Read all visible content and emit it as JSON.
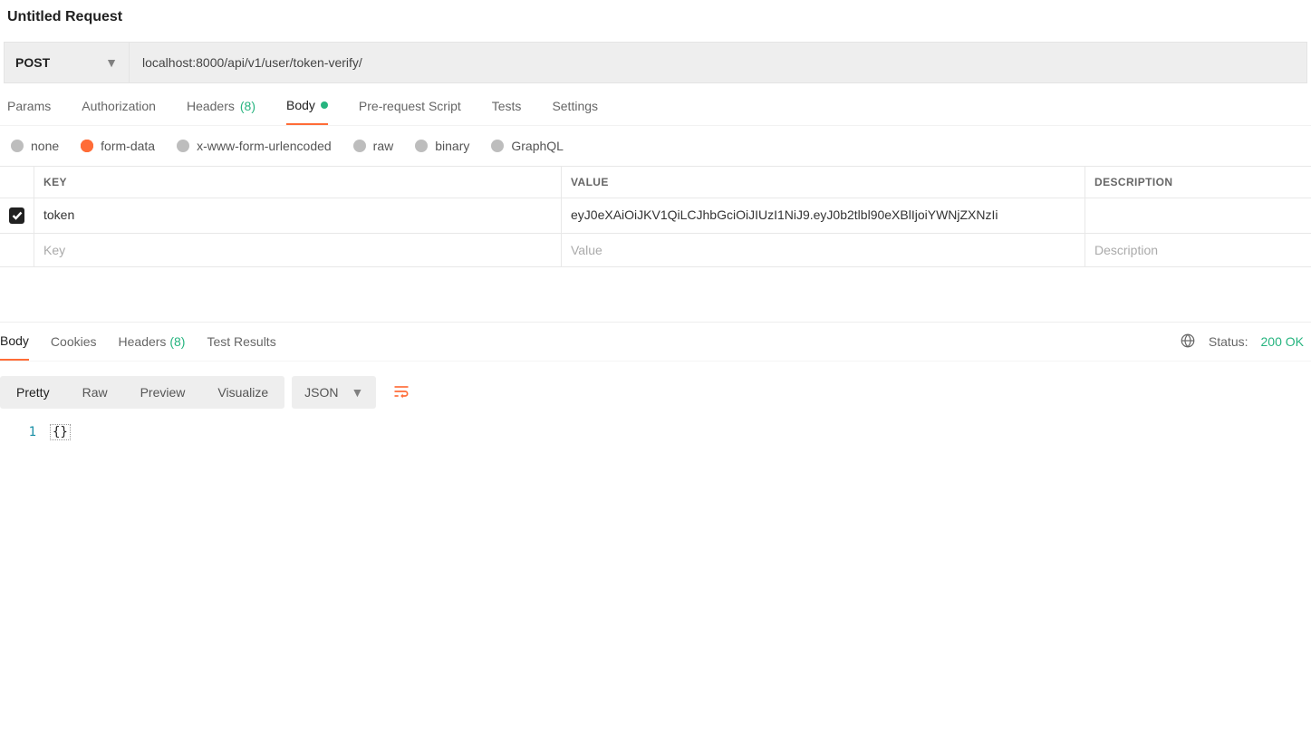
{
  "title": "Untitled Request",
  "request": {
    "method": "POST",
    "url": "localhost:8000/api/v1/user/token-verify/"
  },
  "req_tabs": [
    {
      "label": "Params"
    },
    {
      "label": "Authorization"
    },
    {
      "label": "Headers",
      "count": "(8)"
    },
    {
      "label": "Body"
    },
    {
      "label": "Pre-request Script"
    },
    {
      "label": "Tests"
    },
    {
      "label": "Settings"
    }
  ],
  "body_types": {
    "none": "none",
    "form_data": "form-data",
    "xwww": "x-www-form-urlencoded",
    "raw": "raw",
    "binary": "binary",
    "graphql": "GraphQL"
  },
  "kv": {
    "headers": {
      "key": "KEY",
      "value": "VALUE",
      "desc": "DESCRIPTION"
    },
    "rows": [
      {
        "key": "token",
        "value": "eyJ0eXAiOiJKV1QiLCJhbGciOiJIUzI1NiJ9.eyJ0b2tlbl90eXBlIjoiYWNjZXNzIi"
      }
    ],
    "placeholders": {
      "key": "Key",
      "value": "Value",
      "desc": "Description"
    }
  },
  "resp_tabs": [
    {
      "label": "Body"
    },
    {
      "label": "Cookies"
    },
    {
      "label": "Headers",
      "count": "(8)"
    },
    {
      "label": "Test Results"
    }
  ],
  "status": {
    "label": "Status:",
    "value": "200 OK"
  },
  "view_modes": {
    "pretty": "Pretty",
    "raw": "Raw",
    "preview": "Preview",
    "visualize": "Visualize"
  },
  "format_select": "JSON",
  "response_body": {
    "line1_num": "1",
    "line1_text": "{}"
  }
}
